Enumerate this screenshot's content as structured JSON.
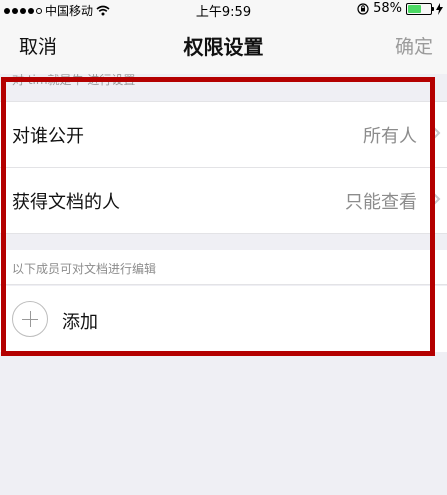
{
  "status_bar": {
    "carrier": "中国移动",
    "time": "上午9:59",
    "battery_percent_text": "58%",
    "battery_level": 0.58
  },
  "nav": {
    "cancel": "取消",
    "title": "权限设置",
    "confirm": "确定"
  },
  "section1": {
    "header_partial": "对 tim就是牛 进行设置",
    "rows": [
      {
        "label": "对谁公开",
        "value": "所有人"
      },
      {
        "label": "获得文档的人",
        "value": "只能查看"
      }
    ]
  },
  "section2": {
    "header": "以下成员可对文档进行编辑",
    "add_label": "添加"
  },
  "colors": {
    "highlight": "#b40000",
    "battery": "#4cd964",
    "background": "#efeff4"
  }
}
